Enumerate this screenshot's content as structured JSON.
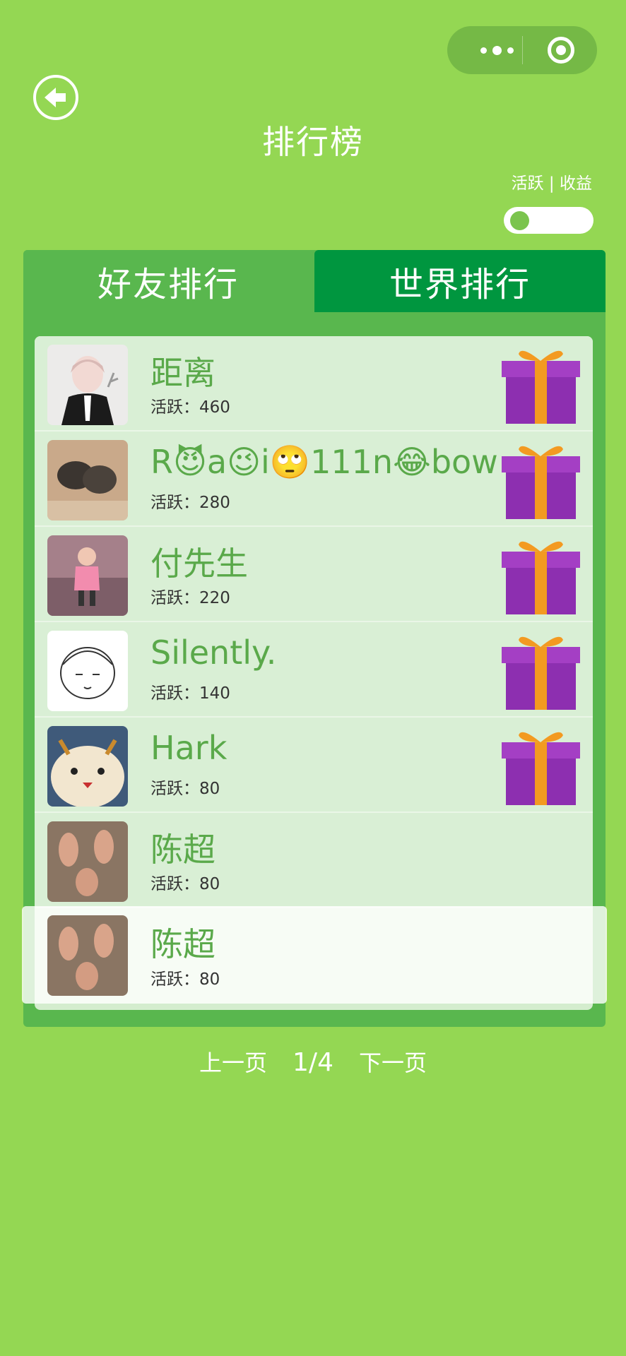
{
  "header": {
    "title": "排行榜",
    "mode_label": "活跃 | 收益"
  },
  "tabs": [
    {
      "label": "好友排行"
    },
    {
      "label": "世界排行"
    }
  ],
  "rows": [
    {
      "name": "距离",
      "score": "活跃：460",
      "gift": true,
      "avatar": "anime-boy-avatar"
    },
    {
      "name": "R😈a😉i🙄111n😂bow",
      "score": "活跃：280",
      "gift": true,
      "avatar": "birds-avatar"
    },
    {
      "name": "付先生",
      "score": "活跃：220",
      "gift": true,
      "avatar": "child-avatar"
    },
    {
      "name": "Silently.",
      "score": "活跃：140",
      "gift": true,
      "avatar": "sketch-face-avatar"
    },
    {
      "name": "Hark",
      "score": "活跃：80",
      "gift": true,
      "avatar": "plush-toy-avatar"
    },
    {
      "name": "陈超",
      "score": "活跃：80",
      "gift": false,
      "avatar": "feet-avatar"
    }
  ],
  "my_row": {
    "name": "陈超",
    "score": "活跃：80"
  },
  "pager": {
    "prev": "上一页",
    "page": "1/4",
    "next": "下一页"
  }
}
